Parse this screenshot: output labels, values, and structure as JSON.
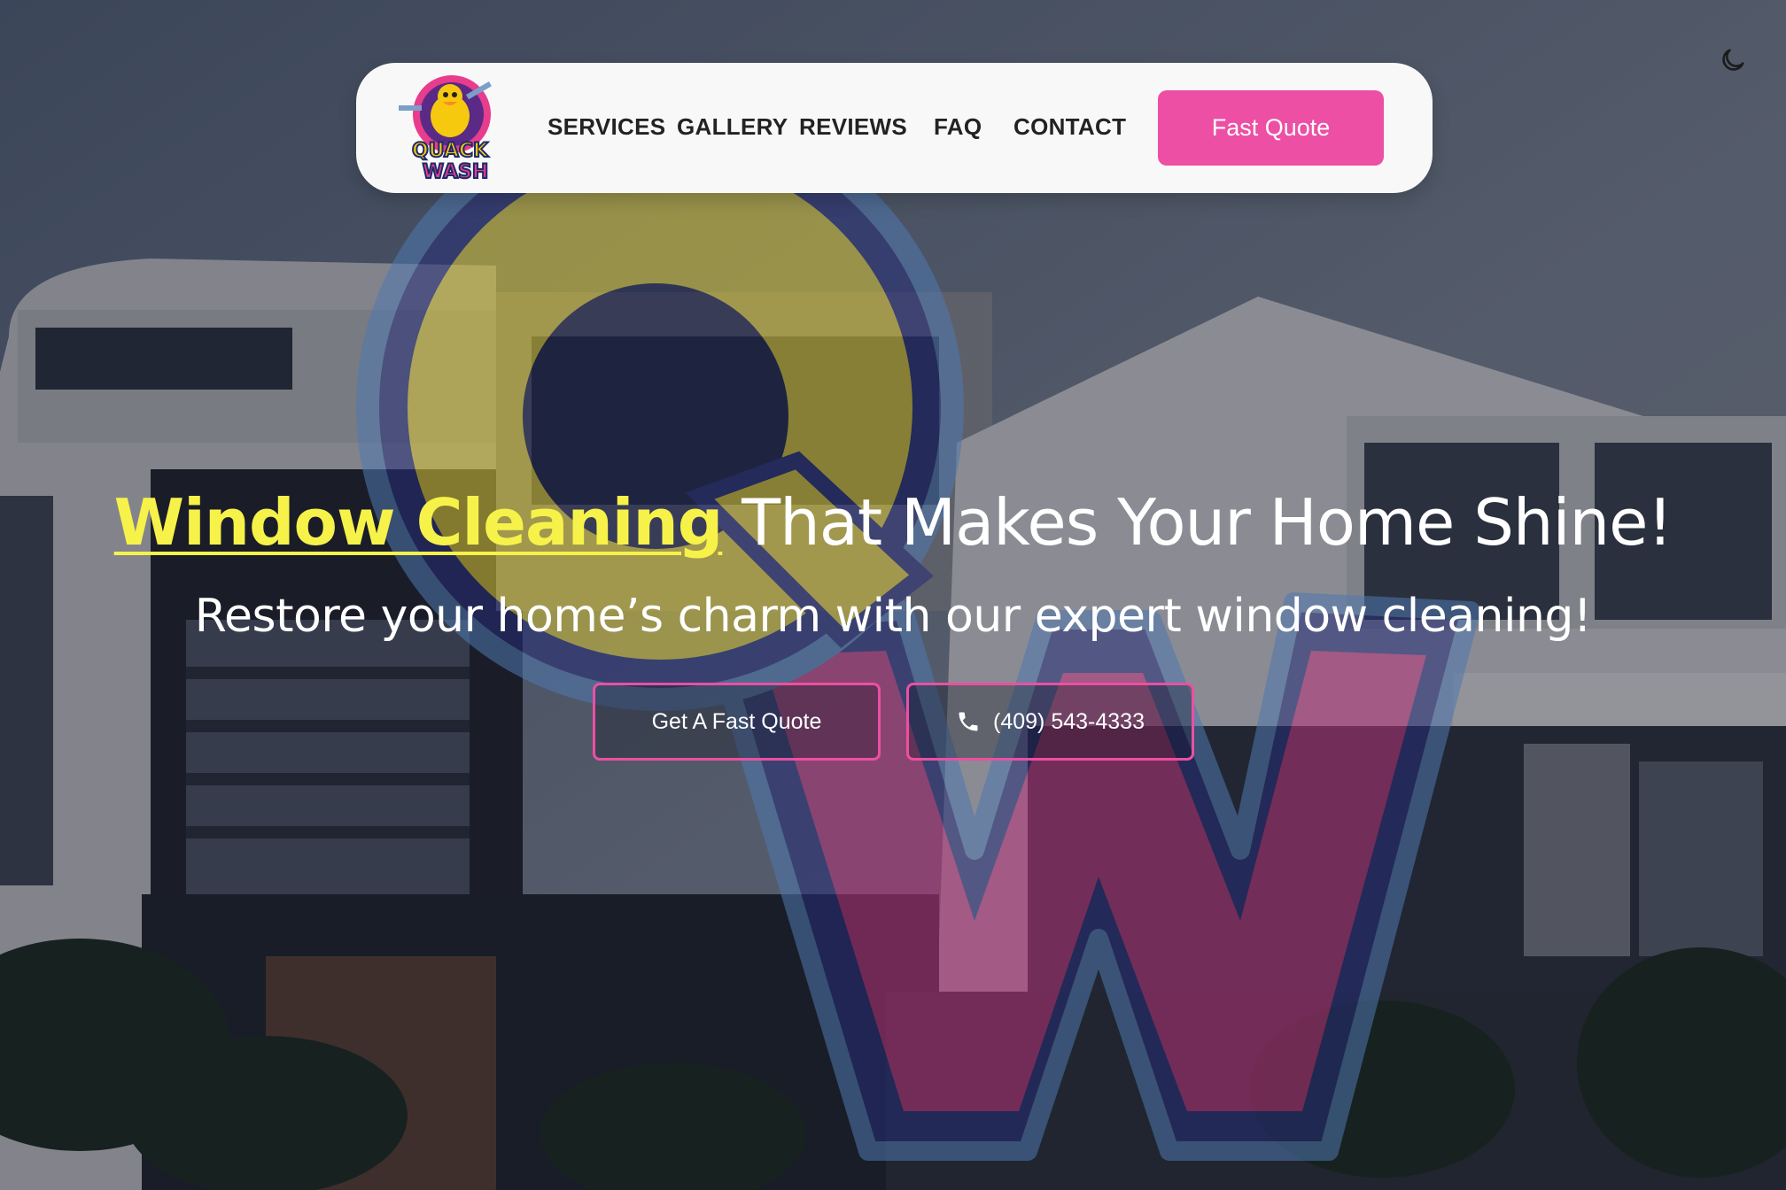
{
  "brand": {
    "logo_top": "QUACK",
    "logo_bottom": "WASH"
  },
  "nav": {
    "items": [
      {
        "label": "SERVICES"
      },
      {
        "label": "GALLERY"
      },
      {
        "label": "REVIEWS"
      },
      {
        "label": "FAQ"
      },
      {
        "label": "CONTACT"
      }
    ],
    "cta_label": "Fast Quote"
  },
  "theme_toggle": {
    "icon": "moon-icon"
  },
  "hero": {
    "title_highlight": "Window Cleaning",
    "title_rest": " That Makes Your Home Shine!",
    "subtitle": "Restore your home’s charm with our expert window cleaning!",
    "primary_cta": "Get A Fast Quote",
    "phone": "(409) 543-4333",
    "phone_icon": "phone-icon"
  },
  "colors": {
    "accent": "#ec4fa3",
    "highlight": "#f6f24a",
    "nav_bg": "#f8f8f8",
    "nav_text": "#222222"
  }
}
